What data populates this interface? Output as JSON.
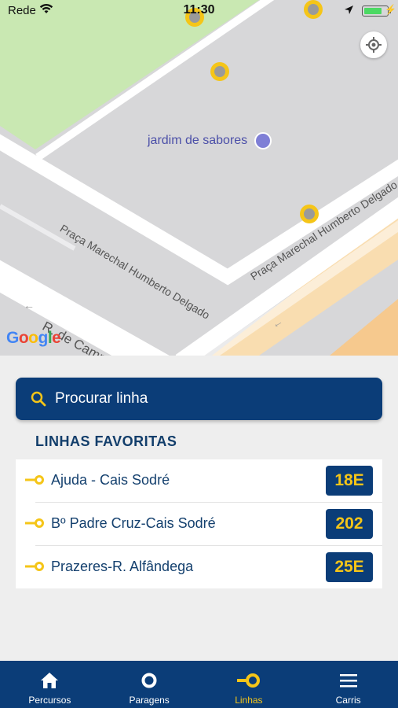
{
  "status_bar": {
    "carrier": "Rede",
    "time": "11:30"
  },
  "map": {
    "poi_name": "jardim de sabores",
    "streets": [
      "Praça Marechal Humberto Delgado",
      "Praça Marechal Humberto Delgado",
      "R. de Campolide"
    ],
    "attribution": "Google"
  },
  "search": {
    "placeholder": "Procurar linha"
  },
  "favorites": {
    "title": "LINHAS FAVORITAS",
    "items": [
      {
        "name": "Ajuda - Cais Sodré",
        "number": "18E"
      },
      {
        "name": "Bº Padre Cruz-Cais Sodré",
        "number": "202"
      },
      {
        "name": "Prazeres-R. Alfândega",
        "number": "25E"
      }
    ]
  },
  "tabs": [
    {
      "label": "Percursos",
      "icon": "home-icon",
      "active": false
    },
    {
      "label": "Paragens",
      "icon": "stop-circle-icon",
      "active": false
    },
    {
      "label": "Linhas",
      "icon": "line-icon",
      "active": true
    },
    {
      "label": "Carris",
      "icon": "menu-icon",
      "active": false
    }
  ],
  "colors": {
    "navy": "#0b3d78",
    "accent_yellow": "#f5c518",
    "park_green": "#c9e8b2"
  }
}
